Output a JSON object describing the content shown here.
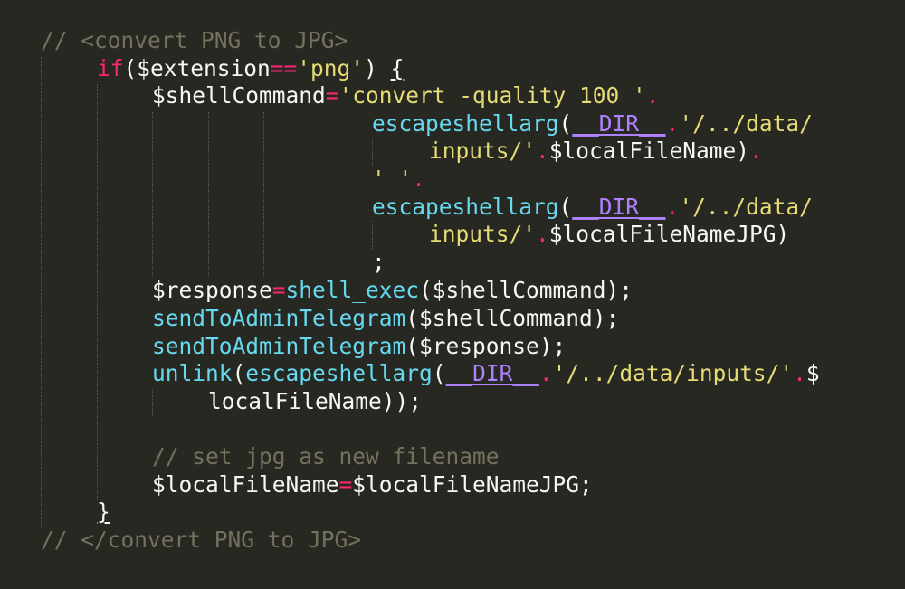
{
  "colors": {
    "background": "#272822",
    "comment": "#75715e",
    "keyword": "#f92672",
    "string": "#e6db74",
    "constant": "#ae81ff",
    "function": "#66d9ef",
    "text": "#f8f8f2"
  },
  "lines": [
    {
      "tokens": [
        {
          "t": "// <convert PNG to JPG>",
          "c": "comment"
        }
      ]
    },
    {
      "tokens": [
        {
          "t": "if",
          "c": "keyword"
        },
        {
          "t": "($extension",
          "c": "default"
        },
        {
          "t": "==",
          "c": "op"
        },
        {
          "t": "'png'",
          "c": "string"
        },
        {
          "t": ") ",
          "c": "default"
        },
        {
          "t": "{",
          "c": "default",
          "u": true
        }
      ]
    },
    {
      "tokens": [
        {
          "t": "$shellCommand",
          "c": "default"
        },
        {
          "t": "=",
          "c": "op"
        },
        {
          "t": "'convert -quality 100 '",
          "c": "string"
        },
        {
          "t": ".",
          "c": "op"
        }
      ]
    },
    {
      "tokens": [
        {
          "t": "escapeshellarg",
          "c": "func"
        },
        {
          "t": "(",
          "c": "default"
        },
        {
          "t": "__DIR__",
          "c": "const",
          "u": true
        },
        {
          "t": ".",
          "c": "op"
        },
        {
          "t": "'/../data/",
          "c": "string"
        }
      ]
    },
    {
      "tokens": [
        {
          "t": "inputs/'",
          "c": "string"
        },
        {
          "t": ".",
          "c": "op"
        },
        {
          "t": "$localFileName)",
          "c": "default"
        },
        {
          "t": ".",
          "c": "op"
        }
      ]
    },
    {
      "tokens": [
        {
          "t": "' '",
          "c": "string"
        },
        {
          "t": ".",
          "c": "op"
        }
      ]
    },
    {
      "tokens": [
        {
          "t": "escapeshellarg",
          "c": "func"
        },
        {
          "t": "(",
          "c": "default"
        },
        {
          "t": "__DIR__",
          "c": "const",
          "u": true
        },
        {
          "t": ".",
          "c": "op"
        },
        {
          "t": "'/../data/",
          "c": "string"
        }
      ]
    },
    {
      "tokens": [
        {
          "t": "inputs/'",
          "c": "string"
        },
        {
          "t": ".",
          "c": "op"
        },
        {
          "t": "$localFileNameJPG)",
          "c": "default"
        }
      ]
    },
    {
      "tokens": [
        {
          "t": ";",
          "c": "default"
        }
      ]
    },
    {
      "tokens": [
        {
          "t": "$response",
          "c": "default"
        },
        {
          "t": "=",
          "c": "op"
        },
        {
          "t": "shell_exec",
          "c": "func"
        },
        {
          "t": "($shellCommand);",
          "c": "default"
        }
      ]
    },
    {
      "tokens": [
        {
          "t": "sendToAdminTelegram",
          "c": "func"
        },
        {
          "t": "($shellCommand);",
          "c": "default"
        }
      ]
    },
    {
      "tokens": [
        {
          "t": "sendToAdminTelegram",
          "c": "func"
        },
        {
          "t": "($response);",
          "c": "default"
        }
      ]
    },
    {
      "tokens": [
        {
          "t": "unlink",
          "c": "func"
        },
        {
          "t": "(",
          "c": "default"
        },
        {
          "t": "escapeshellarg",
          "c": "func"
        },
        {
          "t": "(",
          "c": "default"
        },
        {
          "t": "__DIR__",
          "c": "const",
          "u": true
        },
        {
          "t": ".",
          "c": "op"
        },
        {
          "t": "'/../data/inputs/'",
          "c": "string"
        },
        {
          "t": ".",
          "c": "op"
        },
        {
          "t": "$",
          "c": "default"
        }
      ]
    },
    {
      "tokens": [
        {
          "t": "localFileName));",
          "c": "default"
        }
      ]
    },
    {
      "tokens": []
    },
    {
      "tokens": [
        {
          "t": "// set jpg as new filename",
          "c": "comment"
        }
      ]
    },
    {
      "tokens": [
        {
          "t": "$localFileName",
          "c": "default"
        },
        {
          "t": "=",
          "c": "op"
        },
        {
          "t": "$localFileNameJPG;",
          "c": "default"
        }
      ]
    },
    {
      "tokens": [
        {
          "t": "}",
          "c": "default",
          "u": true
        }
      ]
    },
    {
      "tokens": [
        {
          "t": "// </convert PNG to JPG>",
          "c": "comment"
        }
      ]
    }
  ]
}
